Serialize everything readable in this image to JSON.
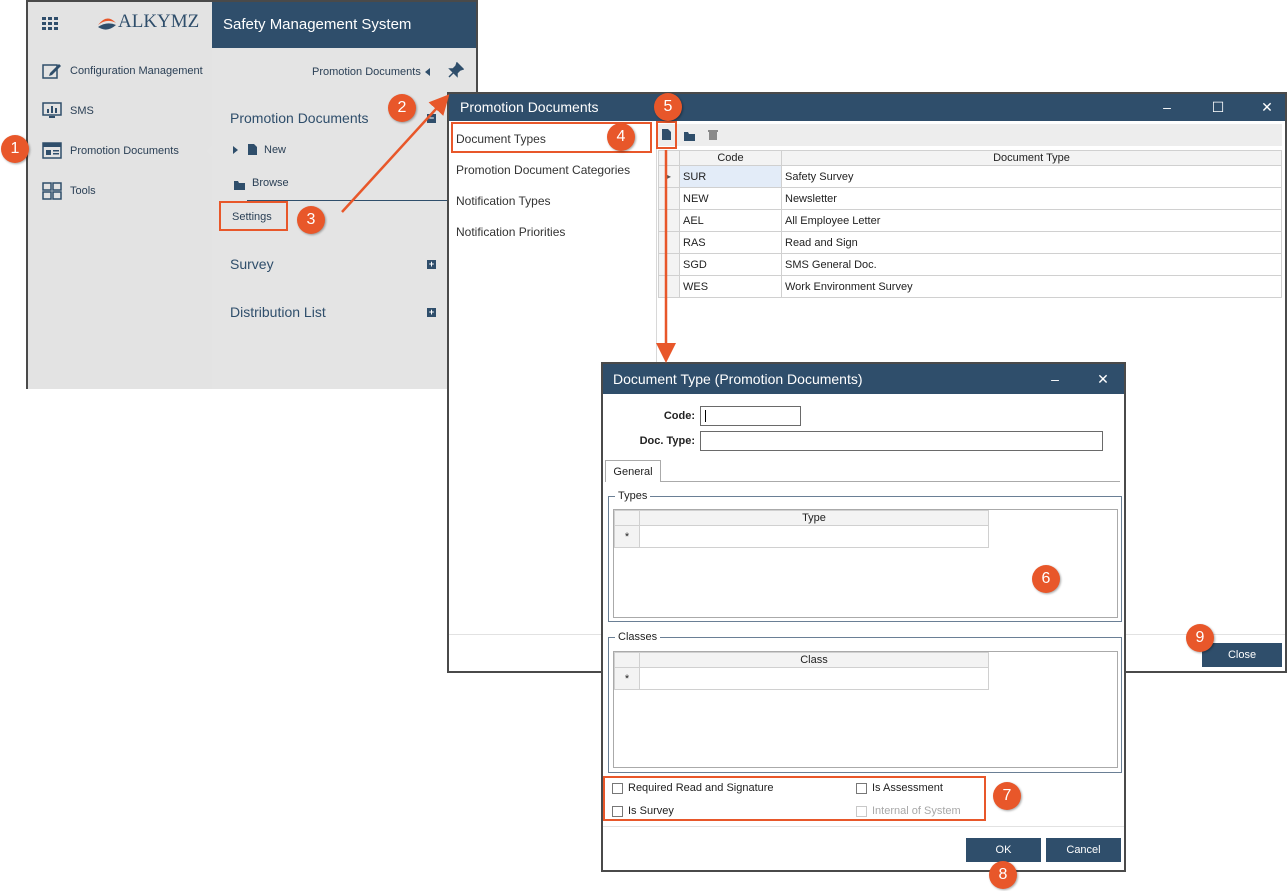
{
  "app": {
    "logo_text": "ALKYMZ",
    "title": "Safety Management System",
    "nav": [
      {
        "label": "Configuration Management",
        "icon": "pencil-icon"
      },
      {
        "label": "SMS",
        "icon": "monitor-chart-icon"
      },
      {
        "label": "Promotion Documents",
        "icon": "document-panel-icon"
      },
      {
        "label": "Tools",
        "icon": "grid-tools-icon"
      }
    ],
    "breadcrumb": "Promotion Documents",
    "panel": {
      "section_title": "Promotion Documents",
      "new_label": "New",
      "browse_label": "Browse",
      "settings_label": "Settings",
      "survey_label": "Survey",
      "distribution_label": "Distribution List"
    }
  },
  "pd_window": {
    "title": "Promotion Documents",
    "menu": [
      "Document Types",
      "Promotion Document Categories",
      "Notification Types",
      "Notification Priorities"
    ],
    "grid_headers": {
      "code": "Code",
      "type": "Document Type"
    },
    "rows": [
      {
        "code": "SUR",
        "type": "Safety Survey"
      },
      {
        "code": "NEW",
        "type": "Newsletter"
      },
      {
        "code": "AEL",
        "type": "All Employee Letter"
      },
      {
        "code": "RAS",
        "type": "Read and Sign"
      },
      {
        "code": "SGD",
        "type": "SMS General Doc."
      },
      {
        "code": "WES",
        "type": "Work Environment Survey"
      }
    ],
    "close_label": "Close"
  },
  "dialog": {
    "title": "Document Type (Promotion Documents)",
    "code_label": "Code:",
    "doctype_label": "Doc. Type:",
    "tab_general": "General",
    "types_legend": "Types",
    "types_header": "Type",
    "classes_legend": "Classes",
    "classes_header": "Class",
    "new_row_marker": "*",
    "cb_required": "Required Read and Signature",
    "cb_assessment": "Is Assessment",
    "cb_survey": "Is Survey",
    "cb_internal": "Internal of System",
    "ok_label": "OK",
    "cancel_label": "Cancel"
  },
  "markers": [
    "1",
    "2",
    "3",
    "4",
    "5",
    "6",
    "7",
    "8",
    "9"
  ],
  "colors": {
    "header": "#2f4e6b",
    "accent": "#e8572a"
  }
}
